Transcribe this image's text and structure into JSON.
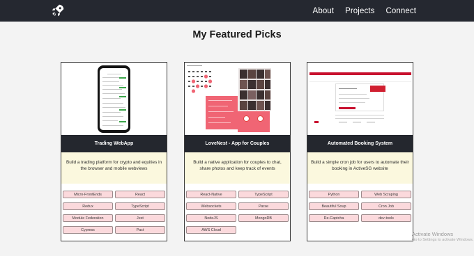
{
  "nav": {
    "logo_icon": "rocket-icon",
    "links": [
      "About",
      "Projects",
      "Connect"
    ]
  },
  "page_title": "My Featured Picks",
  "cards": [
    {
      "title": "Trading WebApp",
      "description": "Build a trading platform for crypto and equities in the browser and mobile webviews",
      "tags": [
        "Micro-FrontEnds",
        "React",
        "Redux",
        "TypeScript",
        "Module Federation",
        "Jest",
        "Cypress",
        "Pact"
      ]
    },
    {
      "title": "LoveNest - App for Couples",
      "description": "Build a native application for couples to chat, share photos and keep track of events",
      "tags": [
        "React-Native",
        "TypeScript",
        "Websockets",
        "Parse",
        "NodeJS",
        "MongoDB",
        "AWS Cloud"
      ]
    },
    {
      "title": "Automated Booking System",
      "description": "Build a simple cron job for users to automate their booking in ActiveSG website",
      "tags": [
        "Python",
        "Web Scraping",
        "Beautiful Soup",
        "Cron Job",
        "Re-Captcha",
        "dev-tools"
      ]
    }
  ],
  "watermark": {
    "title": "Activate Windows",
    "subtitle": "Go to Settings to activate Windows."
  },
  "colors": {
    "navbar": "#252830",
    "card_bar": "#24272e",
    "description_bg": "#fbf8de",
    "tag_bg": "#fbd9dc",
    "accent_red": "#f06574"
  }
}
